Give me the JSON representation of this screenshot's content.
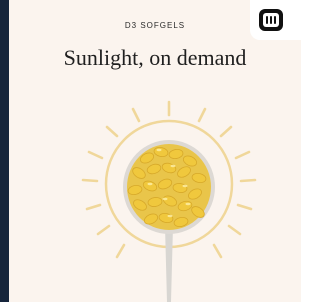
{
  "promo": {
    "eyebrow": "D3 SOFGELS",
    "headline": "Sunlight, on demand"
  },
  "illustration": {
    "icon": "sun-spoon-softgels-illustration",
    "colors": {
      "sun_ring": "#f0d79a",
      "capsule": "#f0c83d",
      "capsule_highlight": "#fff3b0",
      "spoon": "#d8d6d2"
    }
  },
  "badge": {
    "icon": "app-grid-icon",
    "color": "#111111"
  },
  "colors": {
    "background": "#fbf4ee",
    "left_edge": "#16253b",
    "text": "#1f1f1f"
  }
}
